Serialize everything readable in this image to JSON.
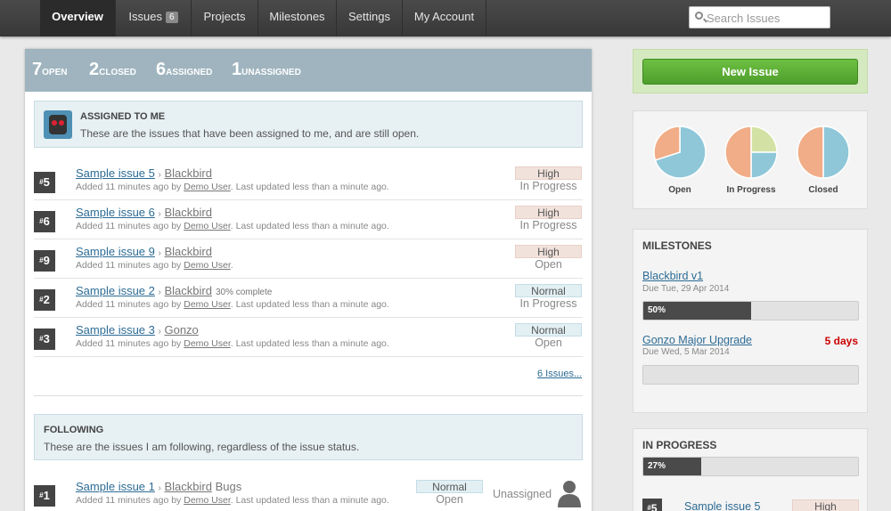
{
  "nav": {
    "items": [
      {
        "label": "Overview"
      },
      {
        "label": "Issues",
        "badge": "6"
      },
      {
        "label": "Projects"
      },
      {
        "label": "Milestones"
      },
      {
        "label": "Settings"
      },
      {
        "label": "My Account"
      }
    ],
    "search_placeholder": "Search Issues"
  },
  "stats": [
    {
      "value": "7",
      "label": "Open"
    },
    {
      "value": "2",
      "label": "Closed"
    },
    {
      "value": "6",
      "label": "Assigned"
    },
    {
      "value": "1",
      "label": "Unassigned"
    }
  ],
  "assigned": {
    "heading": "Assigned to me",
    "description": "These are the issues that have been assigned to me, and are still open.",
    "issues": [
      {
        "num": "5",
        "title": "Sample issue 5",
        "project": "Blackbird",
        "extra": "",
        "added": "Added 11 minutes ago by",
        "user": "Demo User",
        "updated": "Last updated less than a minute ago.",
        "priority": "High",
        "status": "In Progress"
      },
      {
        "num": "6",
        "title": "Sample issue 6",
        "project": "Blackbird",
        "extra": "",
        "added": "Added 11 minutes ago by",
        "user": "Demo User",
        "updated": "Last updated less than a minute ago.",
        "priority": "High",
        "status": "In Progress"
      },
      {
        "num": "9",
        "title": "Sample issue 9",
        "project": "Blackbird",
        "extra": "",
        "added": "Added 11 minutes ago by",
        "user": "Demo User",
        "updated": "",
        "priority": "High",
        "status": "Open"
      },
      {
        "num": "2",
        "title": "Sample issue 2",
        "project": "Blackbird",
        "extra": "30% complete",
        "added": "Added 11 minutes ago by",
        "user": "Demo User",
        "updated": "Last updated less than a minute ago.",
        "priority": "Normal",
        "status": "In Progress"
      },
      {
        "num": "3",
        "title": "Sample issue 3",
        "project": "Gonzo",
        "extra": "",
        "added": "Added 11 minutes ago by",
        "user": "Demo User",
        "updated": "Last updated less than a minute ago.",
        "priority": "Normal",
        "status": "Open"
      }
    ],
    "more_link": "6 Issues..."
  },
  "following": {
    "heading": "Following",
    "description": "These are the issues I am following, regardless of the issue status.",
    "issues": [
      {
        "num": "1",
        "title": "Sample issue 1",
        "project": "Blackbird",
        "category": "Bugs",
        "added": "Added 11 minutes ago by",
        "user": "Demo User",
        "updated": "Last updated less than a minute ago.",
        "priority": "Normal",
        "status": "Open",
        "assignee": "Unassigned"
      }
    ]
  },
  "sidebar": {
    "new_issue": "New Issue",
    "pies": [
      {
        "label": "Open",
        "fractions": [
          0.7,
          0.3
        ]
      },
      {
        "label": "In Progress",
        "fractions": [
          0.25,
          0.25,
          0.5
        ]
      },
      {
        "label": "Closed",
        "fractions": [
          0.5,
          0.5
        ]
      }
    ],
    "milestones": {
      "heading": "Milestones",
      "items": [
        {
          "name": "Blackbird v1",
          "due": "Due Tue, 29 Apr 2014",
          "late": "",
          "progress": 0.5,
          "progress_label": "50%"
        },
        {
          "name": "Gonzo Major Upgrade",
          "due": "Due Wed, 5 Mar 2014",
          "late": "5 days",
          "progress": 0,
          "progress_label": ""
        }
      ]
    },
    "in_progress": {
      "heading": "In Progress",
      "progress": 0.27,
      "progress_label": "27%",
      "issue": {
        "num": "5",
        "title": "Sample issue 5",
        "priority": "High"
      }
    }
  },
  "colors": {
    "pie_blue": "#8fc7d8",
    "pie_orange": "#f0ad88",
    "pie_green": "#d3e2a4",
    "stats_bar": "#9fb4be",
    "new_button": "#5aad35"
  }
}
